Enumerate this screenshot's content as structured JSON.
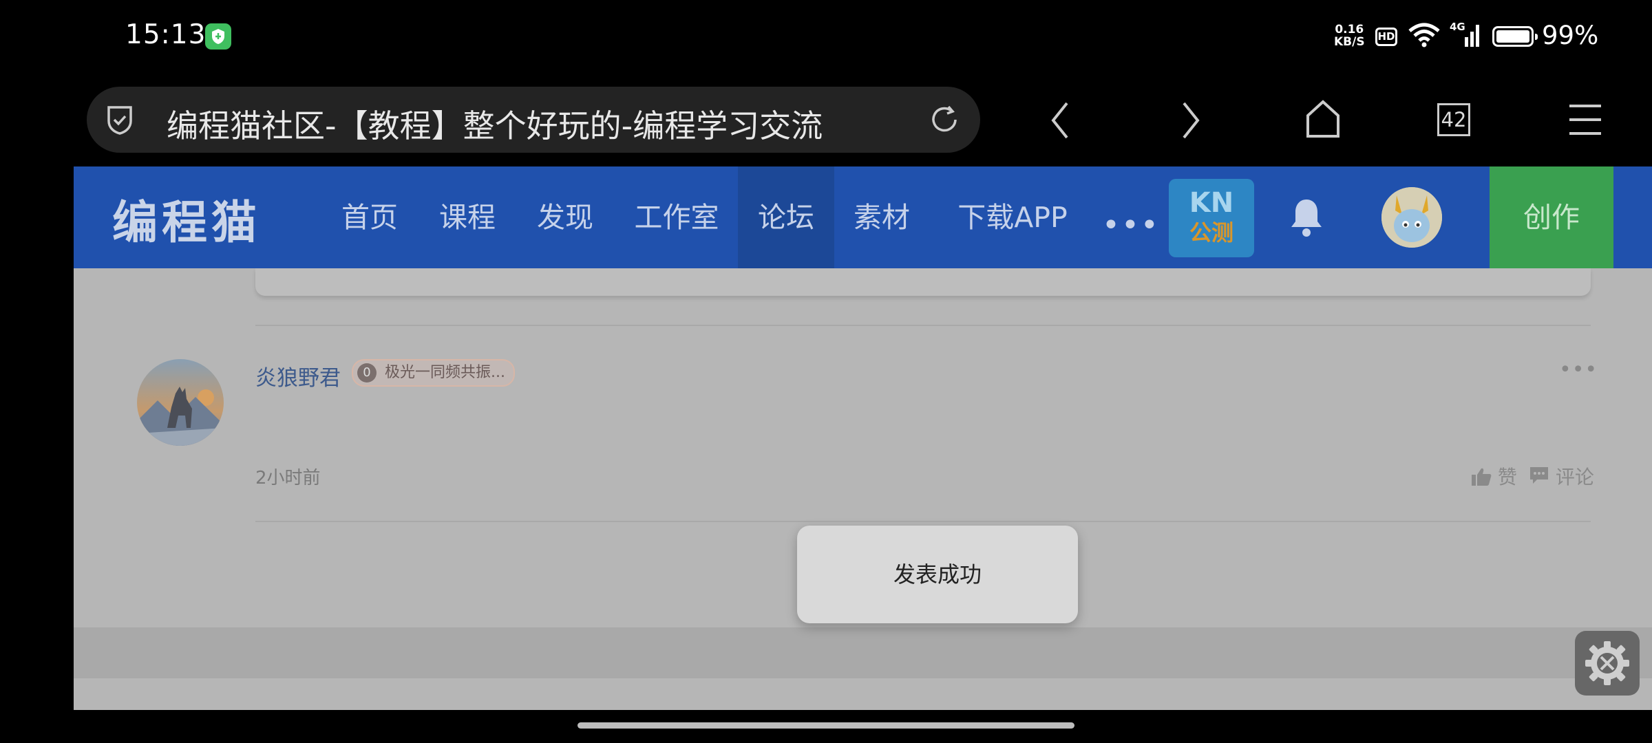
{
  "status_bar": {
    "time": "15:13",
    "net_speed_value": "0.16",
    "net_speed_unit": "KB/S",
    "hd_label": "HD",
    "signal_label": "4G",
    "battery_percent": "99%",
    "icons": [
      "shield-app-icon",
      "wifi-icon",
      "signal-icon",
      "battery-icon"
    ]
  },
  "browser": {
    "page_title": "编程猫社区-【教程】整个好玩的-编程学习交流",
    "tabs_count": "42",
    "icons": [
      "shield-check-icon",
      "reload-icon",
      "back-icon",
      "forward-icon",
      "home-icon",
      "menu-icon"
    ]
  },
  "site_header": {
    "logo": "编程猫",
    "nav": [
      "首页",
      "课程",
      "发现",
      "工作室",
      "论坛",
      "素材",
      "下载APP"
    ],
    "active_nav": "论坛",
    "more": "•••",
    "kn_badge": {
      "title": "KN",
      "subtitle": "公测"
    },
    "create_button": "创作"
  },
  "comment": {
    "author": "炎狼野君",
    "badge_level": "0",
    "badge_text": "极光一同频共振...",
    "more": "•••",
    "time": "2小时前",
    "like_label": "赞",
    "comment_label": "评论"
  },
  "toast": {
    "message": "发表成功"
  },
  "colors": {
    "header_blue": "#2051ad",
    "create_green": "#3aa050",
    "overlay_gray": "#b6b6b6"
  }
}
